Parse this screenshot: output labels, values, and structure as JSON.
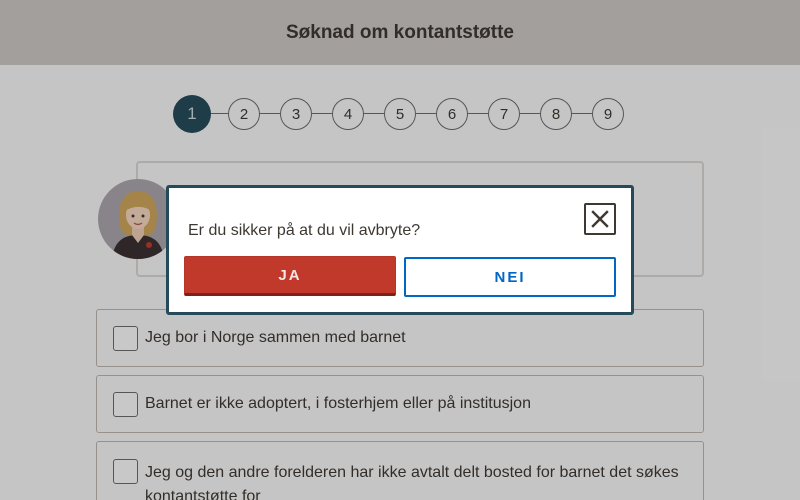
{
  "header": {
    "title": "Søknad om kontantstøtte"
  },
  "stepper": {
    "steps": [
      "1",
      "2",
      "3",
      "4",
      "5",
      "6",
      "7",
      "8",
      "9"
    ],
    "active": 0
  },
  "checkboxes": [
    {
      "label": "Jeg bor i Norge sammen med barnet",
      "checked": false
    },
    {
      "label": "Barnet er ikke adoptert, i fosterhjem eller på institusjon",
      "checked": false
    },
    {
      "label": "Jeg og den andre forelderen har ikke avtalt delt bosted for barnet det søkes kontantstøtte for",
      "checked": false
    }
  ],
  "modal": {
    "question": "Er du sikker på at du vil avbryte?",
    "yes_label": "JA",
    "no_label": "NEI",
    "close_icon": "close-icon"
  },
  "colors": {
    "header_bg": "#c6c2bf",
    "step_active": "#254b5a",
    "modal_border": "#254b5a",
    "yes_button": "#c0392b",
    "no_button": "#0067c5"
  }
}
